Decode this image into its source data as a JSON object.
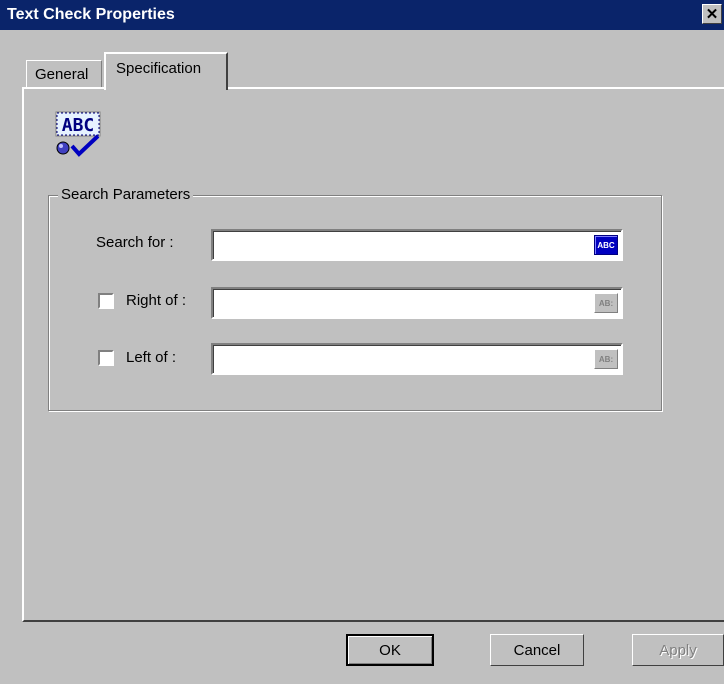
{
  "window": {
    "title": "Text Check Properties",
    "close_glyph": "✕"
  },
  "tabs": [
    {
      "label": "General",
      "selected": false
    },
    {
      "label": "Specification",
      "selected": true
    }
  ],
  "group": {
    "label": "Search Parameters",
    "search_for_label": "Search for  :",
    "right_of_label": "Right of :",
    "left_of_label": "Left of  :",
    "search_for_value": "",
    "right_of_value": "",
    "left_of_value": "",
    "right_of_checked": false,
    "left_of_checked": false,
    "abc_button_label": "ABC",
    "abc_disabled_label": "AB:"
  },
  "buttons": {
    "ok": "OK",
    "cancel": "Cancel",
    "apply": "Apply"
  },
  "icons": {
    "header_icon": "text-check-abc-icon",
    "header_icon_text": "ABC"
  }
}
